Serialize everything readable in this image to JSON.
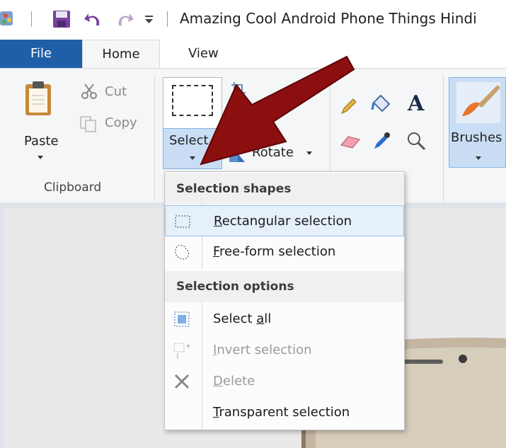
{
  "window": {
    "title": "Amazing Cool Android Phone Things Hindi"
  },
  "tabs": {
    "file": "File",
    "home": "Home",
    "view": "View"
  },
  "ribbon": {
    "clipboard": {
      "paste": "Paste",
      "cut": "Cut",
      "copy": "Copy",
      "group_label": "Clipboard"
    },
    "image": {
      "select": "Select",
      "rotate": "Rotate"
    },
    "tools": {
      "text_glyph": "A"
    },
    "brushes": "Brushes"
  },
  "select_menu": {
    "shapes_header": "Selection shapes",
    "rectangular": {
      "prefix": "",
      "mnemonic": "R",
      "rest": "ectangular selection"
    },
    "freeform": {
      "prefix": "",
      "mnemonic": "F",
      "rest": "ree-form selection"
    },
    "options_header": "Selection options",
    "select_all": {
      "prefix": "Select ",
      "mnemonic": "a",
      "rest": "ll"
    },
    "invert": {
      "prefix": "",
      "mnemonic": "I",
      "rest": "nvert selection"
    },
    "delete": {
      "prefix": "",
      "mnemonic": "D",
      "rest": "elete"
    },
    "transparent": {
      "prefix": "",
      "mnemonic": "T",
      "rest": "ransparent selection"
    }
  },
  "colors": {
    "file_tab": "#1e5fa8",
    "highlight": "#e5f0fb",
    "arrow": "#8b0f0f"
  }
}
